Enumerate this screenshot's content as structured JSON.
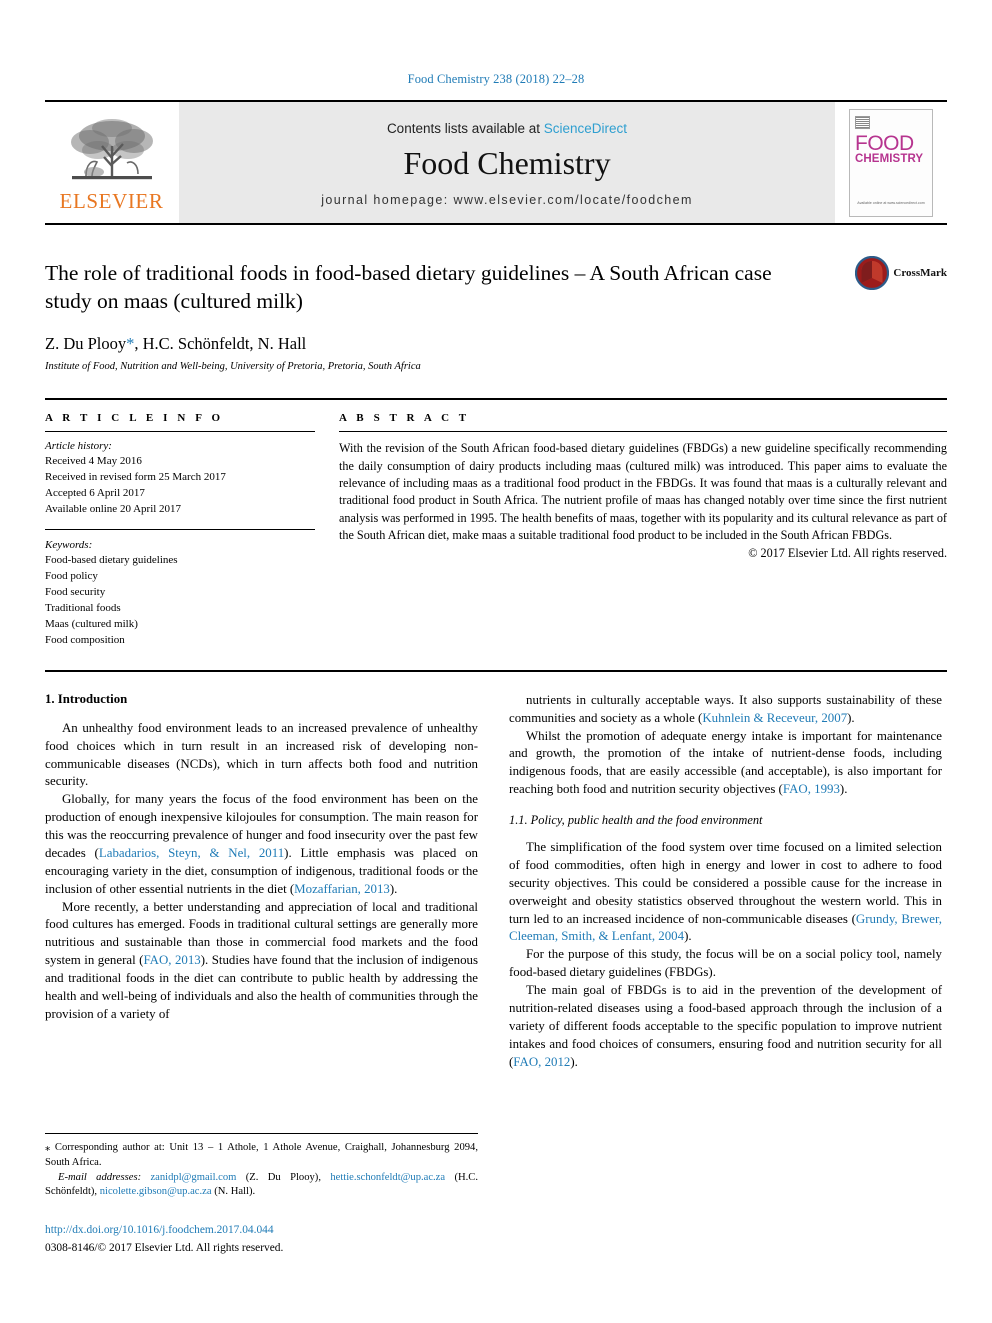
{
  "running_head": "Food Chemistry 238 (2018) 22–28",
  "masthead": {
    "publisher_name": "ELSEVIER",
    "contents_prefix": "Contents lists available at ",
    "contents_link": "ScienceDirect",
    "journal_name": "Food Chemistry",
    "homepage": "journal homepage: www.elsevier.com/locate/foodchem",
    "cover": {
      "line1": "FOOD",
      "line2": "CHEMISTRY",
      "footer": "Available online at www.sciencedirect.com"
    }
  },
  "article": {
    "title": "The role of traditional foods in food-based dietary guidelines – A South African case study on maas (cultured milk)",
    "authors_pre": "Z. Du Plooy",
    "authors_star": "*",
    "authors_post": ", H.C. Schönfeldt, N. Hall",
    "affiliation": "Institute of Food, Nutrition and Well-being, University of Pretoria, Pretoria, South Africa",
    "crossmark_label": "CrossMark"
  },
  "info": {
    "heading": "A R T I C L E   I N F O",
    "history_label": "Article history:",
    "history": [
      "Received 4 May 2016",
      "Received in revised form 25 March 2017",
      "Accepted 6 April 2017",
      "Available online 20 April 2017"
    ],
    "keywords_label": "Keywords:",
    "keywords": [
      "Food-based dietary guidelines",
      "Food policy",
      "Food security",
      "Traditional foods",
      "Maas (cultured milk)",
      "Food composition"
    ]
  },
  "abstract": {
    "heading": "A B S T R A C T",
    "text": "With the revision of the South African food-based dietary guidelines (FBDGs) a new guideline specifically recommending the daily consumption of dairy products including maas (cultured milk) was introduced. This paper aims to evaluate the relevance of including maas as a traditional food product in the FBDGs. It was found that maas is a culturally relevant and traditional food product in South Africa. The nutrient profile of maas has changed notably over time since the first nutrient analysis was performed in 1995. The health benefits of maas, together with its popularity and its cultural relevance as part of the South African diet, make maas a suitable traditional food product to be included in the South African FBDGs.",
    "copyright": "© 2017 Elsevier Ltd. All rights reserved."
  },
  "body": {
    "section1_heading": "1. Introduction",
    "left_paragraphs": [
      {
        "parts": [
          {
            "t": "An unhealthy food environment leads to an increased prevalence of unhealthy food choices which in turn result in an increased risk of developing non-communicable diseases (NCDs), which in turn affects both food and nutrition security.",
            "cite": false
          }
        ]
      },
      {
        "parts": [
          {
            "t": "Globally, for many years the focus of the food environment has been on the production of enough inexpensive kilojoules for consumption. The main reason for this was the reoccurring prevalence of hunger and food insecurity over the past few decades (",
            "cite": false
          },
          {
            "t": "Labadarios, Steyn, & Nel, 2011",
            "cite": true
          },
          {
            "t": "). Little emphasis was placed on encouraging variety in the diet, consumption of indigenous, traditional foods or the inclusion of other essential nutrients in the diet (",
            "cite": false
          },
          {
            "t": "Mozaffarian, 2013",
            "cite": true
          },
          {
            "t": ").",
            "cite": false
          }
        ]
      },
      {
        "parts": [
          {
            "t": "More recently, a better understanding and appreciation of local and traditional food cultures has emerged. Foods in traditional cultural settings are generally more nutritious and sustainable than those in commercial food markets and the food system in general (",
            "cite": false
          },
          {
            "t": "FAO, 2013",
            "cite": true
          },
          {
            "t": "). Studies have found that the inclusion of indigenous and traditional foods in the diet can contribute to public health by addressing the health and well-being of individuals and also the health of communities through the provision of a variety of",
            "cite": false
          }
        ]
      }
    ],
    "right_paragraphs_top": [
      {
        "parts": [
          {
            "t": "nutrients in culturally acceptable ways. It also supports sustainability of these communities and society as a whole (",
            "cite": false
          },
          {
            "t": "Kuhnlein & Receveur, 2007",
            "cite": true
          },
          {
            "t": ").",
            "cite": false
          }
        ]
      },
      {
        "parts": [
          {
            "t": "Whilst the promotion of adequate energy intake is important for maintenance and growth, the promotion of the intake of nutrient-dense foods, including indigenous foods, that are easily accessible (and acceptable), is also important for reaching both food and nutrition security objectives (",
            "cite": false
          },
          {
            "t": "FAO, 1993",
            "cite": true
          },
          {
            "t": ").",
            "cite": false
          }
        ]
      }
    ],
    "section11_heading": "1.1. Policy, public health and the food environment",
    "right_paragraphs_bottom": [
      {
        "parts": [
          {
            "t": "The simplification of the food system over time focused on a limited selection of food commodities, often high in energy and lower in cost to adhere to food security objectives. This could be considered a possible cause for the increase in overweight and obesity statistics observed throughout the western world. This in turn led to an increased incidence of non-communicable diseases (",
            "cite": false
          },
          {
            "t": "Grundy, Brewer, Cleeman, Smith, & Lenfant, 2004",
            "cite": true
          },
          {
            "t": ").",
            "cite": false
          }
        ]
      },
      {
        "parts": [
          {
            "t": "For the purpose of this study, the focus will be on a social policy tool, namely food-based dietary guidelines (FBDGs).",
            "cite": false
          }
        ]
      },
      {
        "parts": [
          {
            "t": "The main goal of FBDGs is to aid in the prevention of the development of nutrition-related diseases using a food-based approach through the inclusion of a variety of different foods acceptable to the specific population to improve nutrient intakes and food choices of consumers, ensuring food and nutrition security for all (",
            "cite": false
          },
          {
            "t": "FAO, 2012",
            "cite": true
          },
          {
            "t": ").",
            "cite": false
          }
        ]
      }
    ]
  },
  "footnotes": {
    "corresponding": "⁎ Corresponding author at: Unit 13 – 1 Athole, 1 Athole Avenue, Craighall, Johannesburg 2094, South Africa.",
    "email_label": "E-mail addresses:",
    "emails": [
      {
        "address": "zanidpl@gmail.com",
        "owner": " (Z. Du Plooy), "
      },
      {
        "address": "hettie.schonfeldt@up.ac.za",
        "owner": " (H.C. Schönfeldt), "
      },
      {
        "address": "nicolette.gibson@up.ac.za",
        "owner": " (N. Hall)."
      }
    ],
    "doi": "http://dx.doi.org/10.1016/j.foodchem.2017.04.044",
    "issn": "0308-8146/© 2017 Elsevier Ltd. All rights reserved."
  },
  "colors": {
    "link_blue": "#1f7bb6",
    "sciencedirect_blue": "#2f9fd0",
    "elsevier_orange": "#e87722",
    "cover_magenta": "#b6348f"
  }
}
